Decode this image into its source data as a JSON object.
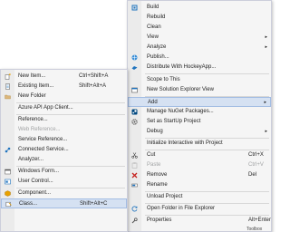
{
  "context_menu": {
    "items": [
      {
        "label": "Build",
        "icon": "build-icon"
      },
      {
        "label": "Rebuild",
        "icon": ""
      },
      {
        "label": "Clean",
        "icon": ""
      },
      {
        "label": "View",
        "icon": "",
        "submenu": true
      },
      {
        "label": "Analyze",
        "icon": "",
        "submenu": true
      },
      {
        "label": "Publish...",
        "icon": "publish-globe-icon"
      },
      {
        "label": "Distribute With HockeyApp...",
        "icon": "hockeyapp-icon"
      },
      {
        "label": "Scope to This",
        "icon": ""
      },
      {
        "label": "New Solution Explorer View",
        "icon": "new-solution-explorer-view-icon"
      },
      {
        "label": "Add",
        "icon": "",
        "submenu": true,
        "highlighted": true
      },
      {
        "label": "Manage NuGet Packages...",
        "icon": "nuget-icon"
      },
      {
        "label": "Set as StartUp Project",
        "icon": "startup-project-gear-icon"
      },
      {
        "label": "Debug",
        "icon": "",
        "submenu": true
      },
      {
        "label": "Initialize Interactive with Project",
        "icon": ""
      },
      {
        "label": "Cut",
        "icon": "cut-scissors-icon",
        "shortcut": "Ctrl+X"
      },
      {
        "label": "Paste",
        "icon": "paste-icon",
        "shortcut": "Ctrl+V",
        "disabled": true
      },
      {
        "label": "Remove",
        "icon": "remove-x-icon",
        "shortcut": "Del"
      },
      {
        "label": "Rename",
        "icon": "rename-icon"
      },
      {
        "label": "Unload Project",
        "icon": ""
      },
      {
        "label": "Open Folder in File Explorer",
        "icon": "open-folder-refresh-icon"
      },
      {
        "label": "Properties",
        "icon": "properties-wrench-icon",
        "shortcut": "Alt+Enter"
      }
    ],
    "submenu_arrow": "▸"
  },
  "add_submenu": {
    "items": [
      {
        "label": "New Item...",
        "shortcut": "Ctrl+Shift+A",
        "icon": "new-item-icon"
      },
      {
        "label": "Existing Item...",
        "shortcut": "Shift+Alt+A",
        "icon": "existing-item-icon"
      },
      {
        "label": "New Folder",
        "shortcut": "",
        "icon": "new-folder-icon"
      },
      {
        "label": "Azure API App Client...",
        "shortcut": "",
        "icon": ""
      },
      {
        "label": "Reference...",
        "shortcut": "",
        "icon": ""
      },
      {
        "label": "Web Reference...",
        "shortcut": "",
        "icon": "",
        "disabled": true
      },
      {
        "label": "Service Reference...",
        "shortcut": "",
        "icon": ""
      },
      {
        "label": "Connected Service...",
        "shortcut": "",
        "icon": "connected-service-icon"
      },
      {
        "label": "Analyzer...",
        "shortcut": "",
        "icon": ""
      },
      {
        "label": "Windows Form...",
        "shortcut": "",
        "icon": "windows-form-icon"
      },
      {
        "label": "User Control...",
        "shortcut": "",
        "icon": "user-control-icon"
      },
      {
        "label": "Component...",
        "shortcut": "",
        "icon": "component-icon"
      },
      {
        "label": "Class...",
        "shortcut": "Shift+Alt+C",
        "icon": "class-icon",
        "highlighted": true
      }
    ]
  },
  "background": {
    "toolbar_fragment": "Toolbox"
  },
  "colors": {
    "menu_bg": "#f5f5f5",
    "highlight": "#d5e1f2",
    "highlight_border": "#a3bde3",
    "disabled_text": "#a2a4a5",
    "accent_blue": "#1e73be"
  }
}
